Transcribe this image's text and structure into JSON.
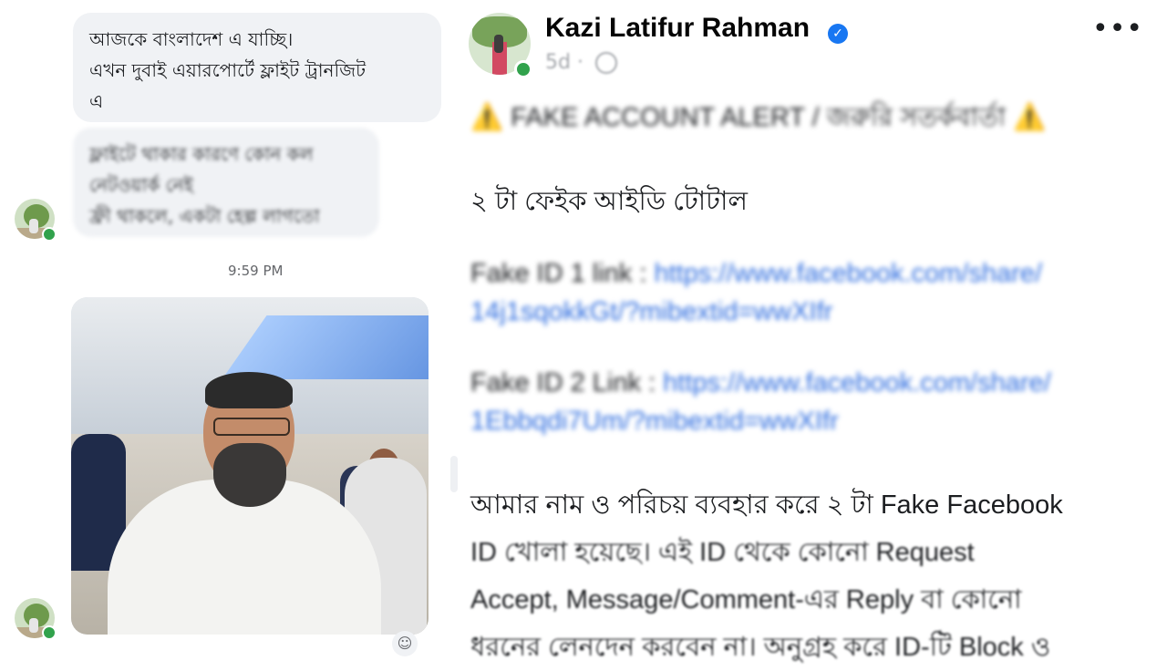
{
  "messenger": {
    "message1_lines": [
      "আজকে বাংলাদেশ এ যাচ্ছি।",
      "এখন দুবাই এয়ারপোর্টে ফ্লাইট ট্রানজিট",
      "এ"
    ],
    "message2_lines": [
      "ফ্লাইটে থাকার কারণে কোন কল",
      "নেটওয়ার্ক নেই",
      "ফ্রী থাকলে, একটা হেল্প লাগতো"
    ],
    "timestamp": "9:59 PM",
    "reaction_icon": "add-reaction-icon"
  },
  "post": {
    "author_name": "Kazi Latifur Rahman",
    "verified_icon": "verified-badge-icon",
    "time_ago": "5d",
    "privacy_icon": "globe-icon",
    "more_icon": "more-options-icon",
    "alert_line": "FAKE ACCOUNT ALERT / জরুরি সতর্কবার্তা",
    "alert_icon": "⚠️",
    "total_line": "২ টা ফেইক আইডি টোটাল",
    "fake1_label": "Fake ID 1 link : ",
    "fake1_url_part1": "https://www.facebook.com/share/",
    "fake1_url_part2": "14j1sqokkGt/?mibextid=wwXIfr",
    "fake2_label": "Fake ID 2 Link : ",
    "fake2_url_part1": "https://www.facebook.com/share/",
    "fake2_url_part2": "1Ebbqdi7Um/?mibextid=wwXIfr",
    "para_line1": "আমার নাম ও পরিচয় ব্যবহার করে ২ টা Fake Facebook",
    "para_line2": "ID খোলা হয়েছে। এই ID থেকে কোনো Request",
    "para_line3": "Accept, Message/Comment-এর Reply বা কোনো",
    "para_line4": "ধরনের লেনদেন করবেন না। অনুগ্রহ করে ID-টি Block ও"
  },
  "colors": {
    "online": "#31a24c",
    "verified": "#1877f2",
    "link": "#2d6cdf",
    "bubble": "#f0f2f5",
    "warning": "#f7b500"
  }
}
